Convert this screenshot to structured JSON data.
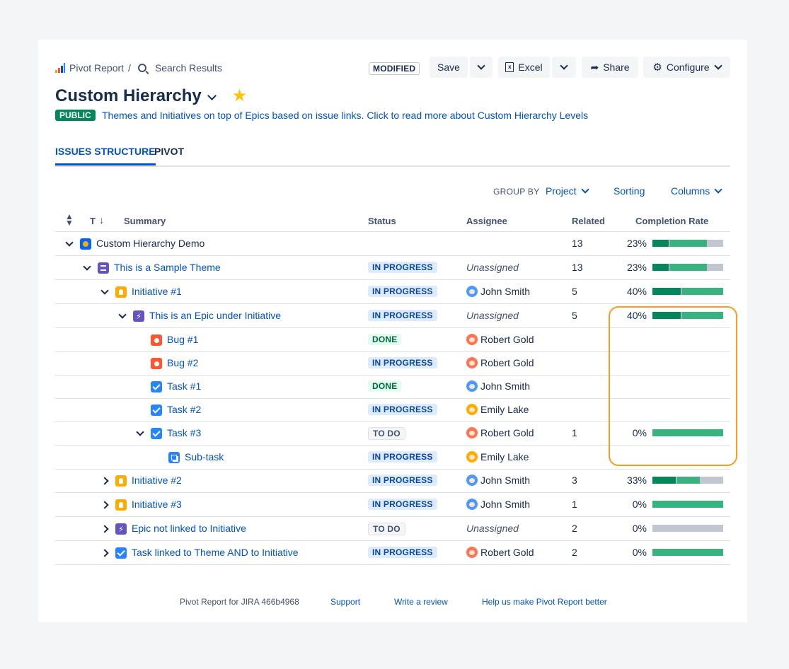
{
  "breadcrumb": {
    "app": "Pivot Report",
    "sep": "/",
    "current": "Search Results"
  },
  "header": {
    "modified_badge": "MODIFIED",
    "save_label": "Save",
    "excel_label": "Excel",
    "share_label": "Share",
    "configure_label": "Configure",
    "title": "Custom Hierarchy",
    "visibility_badge": "PUBLIC",
    "description": "Themes and Initiatives on top of Epics based on issue links. Click to read more about Custom Hierarchy Levels"
  },
  "tabs": [
    {
      "label": "ISSUES STRUCTURE",
      "active": true
    },
    {
      "label": "PIVOT",
      "active": false
    }
  ],
  "toolbar": {
    "group_by_label": "GROUP BY",
    "group_by_value": "Project",
    "sorting_label": "Sorting",
    "columns_label": "Columns"
  },
  "columns": {
    "t": "T",
    "summary": "Summary",
    "status": "Status",
    "assignee": "Assignee",
    "related": "Related",
    "completion": "Completion Rate"
  },
  "colors": {
    "accent": "#0052cc",
    "done": "#00875a",
    "in_progress": "#36b37e",
    "todo": "#c1c7d0",
    "highlight": "#ff991f"
  },
  "rows": [
    {
      "level": 0,
      "toggle": "expanded",
      "type": "demo-icon",
      "summary": "Custom Hierarchy Demo",
      "status": "",
      "assignee": "",
      "related": "13",
      "pct": "23%",
      "done": 0.23,
      "prog": 0.54
    },
    {
      "level": 1,
      "toggle": "expanded",
      "type": "theme-icon",
      "summary": "This is a Sample Theme",
      "status": "IN PROGRESS",
      "assignee": "Unassigned",
      "related": "13",
      "pct": "23%",
      "done": 0.23,
      "prog": 0.54
    },
    {
      "level": 2,
      "toggle": "expanded",
      "type": "initiative-icon",
      "summary": "Initiative #1",
      "status": "IN PROGRESS",
      "assignee": "John Smith",
      "related": "5",
      "pct": "40%",
      "done": 0.4,
      "prog": 0.6
    },
    {
      "level": 3,
      "toggle": "expanded",
      "type": "epic-icon",
      "summary": "This is an Epic under Initiative",
      "status": "IN PROGRESS",
      "assignee": "Unassigned",
      "related": "5",
      "pct": "40%",
      "done": 0.4,
      "prog": 0.6
    },
    {
      "level": 4,
      "toggle": "none",
      "type": "bug-icon",
      "summary": "Bug #1",
      "status": "DONE",
      "assignee": "Robert Gold",
      "related": "",
      "pct": "",
      "done": null,
      "prog": null
    },
    {
      "level": 4,
      "toggle": "none",
      "type": "bug-icon",
      "summary": "Bug #2",
      "status": "IN PROGRESS",
      "assignee": "Robert Gold",
      "related": "",
      "pct": "",
      "done": null,
      "prog": null
    },
    {
      "level": 4,
      "toggle": "none",
      "type": "task-icon",
      "summary": "Task #1",
      "status": "DONE",
      "assignee": "John Smith",
      "related": "",
      "pct": "",
      "done": null,
      "prog": null
    },
    {
      "level": 4,
      "toggle": "none",
      "type": "task-icon",
      "summary": "Task #2",
      "status": "IN PROGRESS",
      "assignee": "Emily Lake",
      "related": "",
      "pct": "",
      "done": null,
      "prog": null
    },
    {
      "level": 4,
      "toggle": "expanded",
      "type": "task-icon",
      "summary": "Task #3",
      "status": "TO DO",
      "assignee": "Robert Gold",
      "related": "1",
      "pct": "0%",
      "done": 0,
      "prog": 1
    },
    {
      "level": 5,
      "toggle": "none",
      "type": "subtask-icon",
      "summary": "Sub-task",
      "status": "IN PROGRESS",
      "assignee": "Emily Lake",
      "related": "",
      "pct": "",
      "done": null,
      "prog": null
    },
    {
      "level": 2,
      "toggle": "collapsed",
      "type": "initiative-icon",
      "summary": "Initiative #2",
      "status": "IN PROGRESS",
      "assignee": "John Smith",
      "related": "3",
      "pct": "33%",
      "done": 0.33,
      "prog": 0.34
    },
    {
      "level": 2,
      "toggle": "collapsed",
      "type": "initiative-icon",
      "summary": "Initiative #3",
      "status": "IN PROGRESS",
      "assignee": "John Smith",
      "related": "1",
      "pct": "0%",
      "done": 0,
      "prog": 1
    },
    {
      "level": 2,
      "toggle": "collapsed",
      "type": "epic-icon",
      "summary": "Epic not linked to Initiative",
      "status": "TO DO",
      "assignee": "Unassigned",
      "related": "2",
      "pct": "0%",
      "done": 0,
      "prog": 0
    },
    {
      "level": 2,
      "toggle": "collapsed",
      "type": "task-icon",
      "summary": "Task linked to Theme AND to Initiative",
      "status": "IN PROGRESS",
      "assignee": "Robert Gold",
      "related": "2",
      "pct": "0%",
      "done": 0,
      "prog": 1
    }
  ],
  "footer": {
    "product": "Pivot Report for JIRA 466b4968",
    "support": "Support",
    "review": "Write a review",
    "feedback": "Help us make Pivot Report better"
  }
}
